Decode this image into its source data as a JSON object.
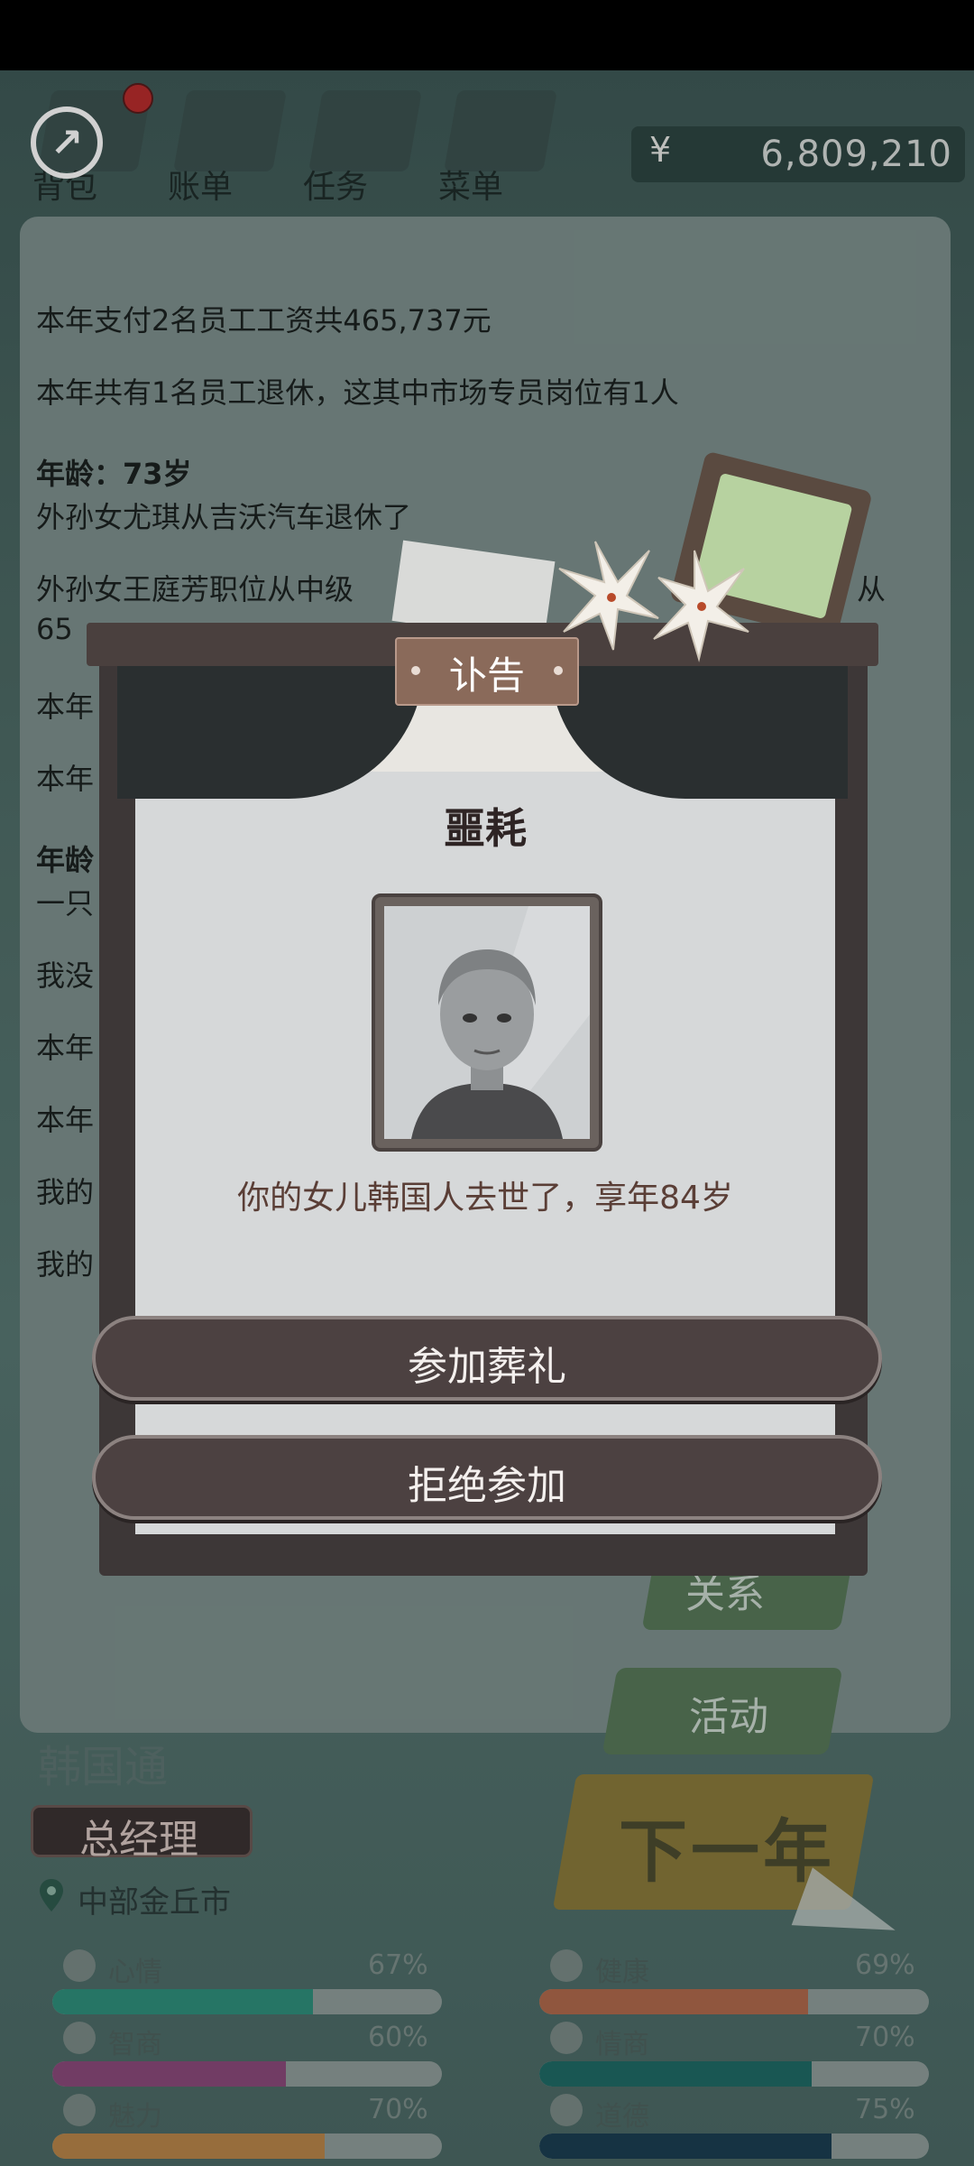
{
  "top_bar": {
    "tabs": [
      "背包",
      "账单",
      "任务",
      "菜单"
    ],
    "currency_symbol": "¥",
    "money": "6,809,210"
  },
  "log": {
    "lines": [
      {
        "text": "本年支付2名员工工资共465,737元",
        "bold": false
      },
      {
        "text": "本年共有1名员工退休，这其中市场专员岗位有1人",
        "bold": false
      },
      {
        "text": "年龄：73岁",
        "bold": true
      },
      {
        "text": "外孙女尤琪从吉沃汽车退休了",
        "bold": false
      },
      {
        "text": "外孙女王庭芳职位从中级",
        "bold": false
      },
      {
        "text": "65",
        "bold": false
      },
      {
        "text": "本年",
        "bold": false
      },
      {
        "text": "本年",
        "bold": false
      },
      {
        "text": "年龄",
        "bold": true
      },
      {
        "text": "一只",
        "bold": false
      },
      {
        "text": "我没",
        "bold": false
      },
      {
        "text": "本年",
        "bold": false
      },
      {
        "text": "本年",
        "bold": false
      },
      {
        "text": "我的",
        "bold": false
      },
      {
        "text": "我的",
        "bold": false
      }
    ],
    "line4_tail": "从"
  },
  "side_buttons": {
    "relations": "关系",
    "activity": "活动",
    "next_year": "下一年"
  },
  "character": {
    "name": "韩国通",
    "title": "总经理",
    "location": "中部金丘市"
  },
  "stats": [
    {
      "label": "心情",
      "value": "67%",
      "fraction": 0.67,
      "color": "#2f8f7c"
    },
    {
      "label": "健康",
      "value": "69%",
      "fraction": 0.69,
      "color": "#b06a4c"
    },
    {
      "label": "智商",
      "value": "60%",
      "fraction": 0.6,
      "color": "#8a4a7a"
    },
    {
      "label": "情商",
      "value": "70%",
      "fraction": 0.7,
      "color": "#1f6b66"
    },
    {
      "label": "魅力",
      "value": "70%",
      "fraction": 0.7,
      "color": "#b9864a"
    },
    {
      "label": "道德",
      "value": "75%",
      "fraction": 0.75,
      "color": "#1c3f52"
    }
  ],
  "dialog": {
    "title": "讣告",
    "heading": "噩耗",
    "message": "你的女儿韩国人去世了，享年84岁",
    "buttons": {
      "attend": "参加葬礼",
      "decline": "拒绝参加"
    }
  }
}
